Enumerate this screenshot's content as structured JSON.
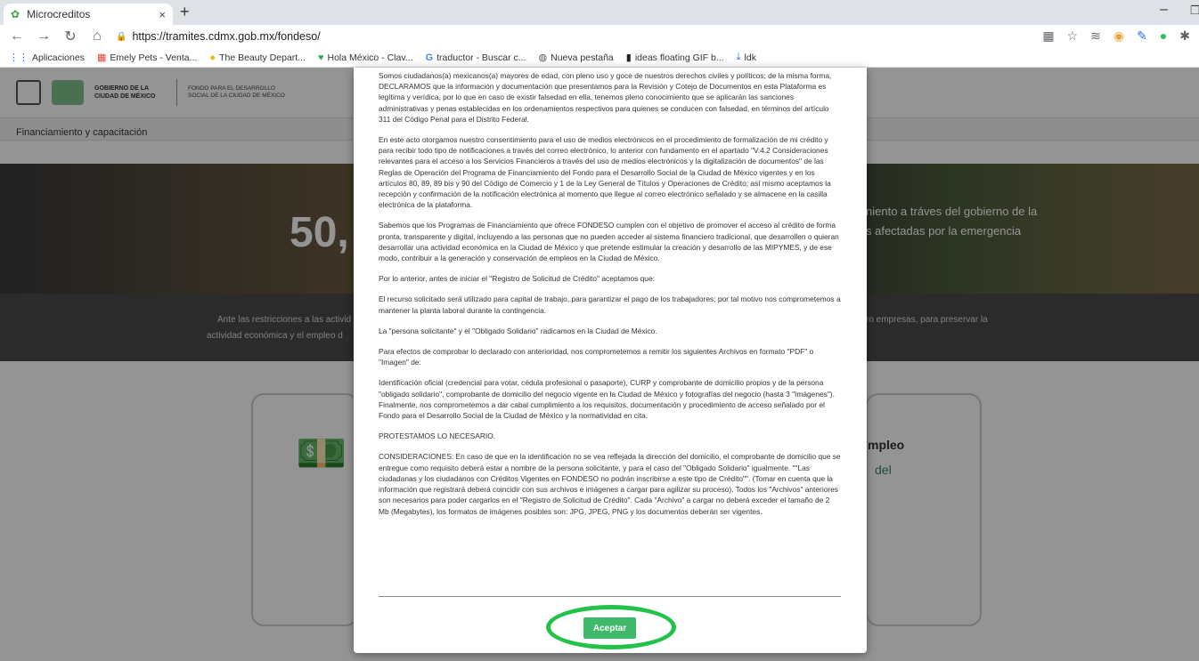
{
  "browser": {
    "tab_title": "Microcreditos",
    "tab_close": "×",
    "new_tab": "+",
    "url": "https://tramites.cdmx.gob.mx/fondeso/",
    "win_min": "–",
    "win_max": "❐",
    "bookmarks": [
      {
        "label": "Aplicaciones",
        "icon": "apps-icon"
      },
      {
        "label": "Emely Pets - Venta...",
        "icon": "store-icon"
      },
      {
        "label": "The Beauty Depart...",
        "icon": "circle-icon"
      },
      {
        "label": "Hola México - Clav...",
        "icon": "heart-icon"
      },
      {
        "label": "traductor - Buscar c...",
        "icon": "google-icon"
      },
      {
        "label": "Nueva pestaña",
        "icon": "globe-icon"
      },
      {
        "label": "ideas floating GIF b...",
        "icon": "file-icon"
      },
      {
        "label": "ldk",
        "icon": "download-icon"
      }
    ]
  },
  "site": {
    "logo_line1": "GOBIERNO DE LA",
    "logo_line2": "CIUDAD DE MÉXICO",
    "logo2_line1": "FONDO PARA EL DESARROLLO",
    "logo2_line2": "SOCIAL DE LA CIUDAD DE MÉXICO",
    "subnav": "Financiamiento y capacitación",
    "hero_number": "50,",
    "hero_right1": "niento a tráves del gobierno de la",
    "hero_right2": "s afectadas por la emergencia",
    "band_left1": "Ante las restricciones a las activid",
    "band_left2": "actividad económica y el empleo d",
    "band_right1": "ro empresas, para preservar la",
    "card_right_t1": "mpleo",
    "card_right_t2": "del"
  },
  "modal": {
    "paragraphs": [
      "Somos ciudadanos(a) mexicanos(a) mayores de edad, con pleno uso y goce de nuestros derechos civiles y políticos; de la misma forma, DECLARAMOS que la información y documentación que presentamos para la Revisión y Cotejo de Documentos en esta Plataforma es legítima y verídica, por lo que en caso de existir falsedad en ella, tenemos pleno conocimiento que se aplicarán las sanciones administrativas y penas establecidas en los ordenamientos respectivos para quienes se conducen con falsedad, en términos del artículo 311 del Código Penal para el Distrito Federal.",
      "En este acto otorgamos nuestro consentimiento para el uso de medios electrónicos en el procedimiento de formalización de mi crédito y para recibir todo tipo de notificaciones a través del correo electrónico, lo anterior con fundamento en el apartado \"V.4.2 Consideraciones relevantes para el acceso a los Servicios Financieros a través del uso de medios electrónicos y la digitalización de documentos\" de las Reglas de Operación del Programa de Financiamiento del Fondo para el Desarrollo Social de la Ciudad de México vigentes y en los artículos 80, 89, 89 bis y 90 del Código de Comercio y 1 de la Ley General de Títulos y Operaciones de Crédito; así mismo aceptamos la recepción y confirmación de la notificación electrónica al momento que llegue al correo electrónico señalado y se almacene en la casilla electrónica de la plataforma.",
      "Sabemos que los Programas de Financiamiento que ofrece FONDESO cumplen con el objetivo de promover el acceso al crédito de forma pronta, transparente y digital, incluyendo a las personas que no pueden acceder al sistema financiero tradicional, que desarrollen o quieran desarrollar una actividad económica en la Ciudad de México y que pretende estimular la creación y desarrollo de las MIPYMES, y de ese modo, contribuir a la generación y conservación de empleos en la Ciudad de México.",
      "Por lo anterior, antes de iniciar el \"Registro de Solicitud de Crédito\" aceptamos que:",
      "El recurso solicitado será utilizado para capital de trabajo, para garantizar el pago de los trabajadores; por tal motivo nos comprometemos a mantener la planta laboral durante la contingencia.",
      "La \"persona solicitante\" y el \"Obligado Solidario\" radicamos en la Ciudad de México.",
      "Para efectos de comprobar lo declarado con anterioridad, nos comprometemos a remitir los siguientes Archivos en formato \"PDF\" o \"Imagen\" de:",
      "Identificación oficial (credencial para votar, cédula profesional o pasaporte), CURP y comprobante de domicilio propios y de la persona \"obligado solidario\", comprobante de domicilio del negocio vigente en la Ciudad de México y fotografías del negocio (hasta 3 \"Imágenes\"). Finalmente, nos comprometemos a dar cabal cumplimiento a los requisitos, documentación y procedimiento de acceso señalado por el Fondo para el Desarrollo Social de la Ciudad de México y la normatividad en cita.",
      "PROTESTAMOS LO NECESARIO.",
      "CONSIDERACIONES: En caso de que en la identificación no se vea reflejada la dirección del domicilio, el comprobante de domicilio que se entregue como requisito deberá estar a nombre de la persona solicitante, y para el caso del \"Obligado Solidario\" igualmente. \"\"Las ciudadanas y los ciudadanos con Créditos Vigentes en FONDESO no podrán inscribirse a este tipo de Crédito\"\". (Tomar en cuenta que la información que registrará deberá coincidir con sus archivos e imágenes a cargar para agilizar su proceso). Todos los \"Archivos\" anteriores son necesarios para poder cargarlos en el \"Registro de Solicitud de Crédito\". Cada \"Archivo\" a cargar no deberá exceder el tamaño de 2 Mb (Megabytes), los formatos de imágenes posibles son: JPG, JPEG, PNG y los documentos deberán ser vigentes."
    ],
    "accept_label": "Aceptar"
  },
  "colors": {
    "accent": "#3fba6a",
    "annotation": "#22c24a"
  }
}
